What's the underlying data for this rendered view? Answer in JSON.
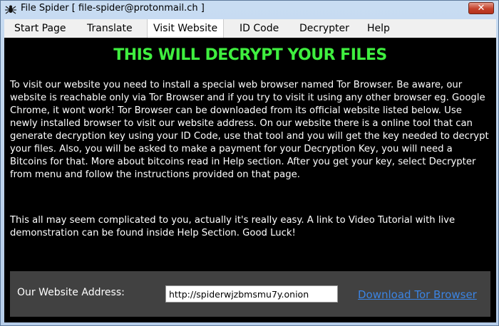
{
  "window": {
    "title": "File Spider [ file-spider@protonmail.ch ]",
    "close_label": "✕"
  },
  "menu": {
    "items": [
      {
        "label": "Start Page"
      },
      {
        "label": "Translate"
      },
      {
        "label": "Visit Website"
      },
      {
        "label": "ID Code"
      },
      {
        "label": "Decrypter"
      },
      {
        "label": "Help"
      }
    ],
    "active": "Visit Website"
  },
  "main": {
    "heading": "THIS WILL DECRYPT YOUR FILES",
    "paragraph1": "To visit our website you need to install a special web browser named Tor Browser. Be aware, our website is reachable only via Tor Browser and if you try to visit it using any other browser eg. Google Chrome, it wont work! Tor Browser can be downloaded from its official website listed below. Use newly installed browser to visit our website address. On our website there is a online tool that can generate decryption key using your ID Code, use that tool and you will get the key needed to decrypt your files. Also, you will be asked to make a payment for your Decryption Key, you will need a Bitcoins for that. More about bitcoins read in Help section. After you get your key, select Decrypter from menu and follow the instructions provided on that page.",
    "paragraph2": "This all may seem complicated to you, actually it's really easy. A link to Video Tutorial with live demonstration can be found inside Help Section. Good Luck!"
  },
  "address_panel": {
    "label": "Our Website Address:",
    "value": "http://spiderwjzbmsmu7y.onion",
    "download_link": "Download Tor Browser"
  },
  "colors": {
    "heading": "#3fef3f",
    "link": "#3b84e3",
    "background": "#000000"
  }
}
